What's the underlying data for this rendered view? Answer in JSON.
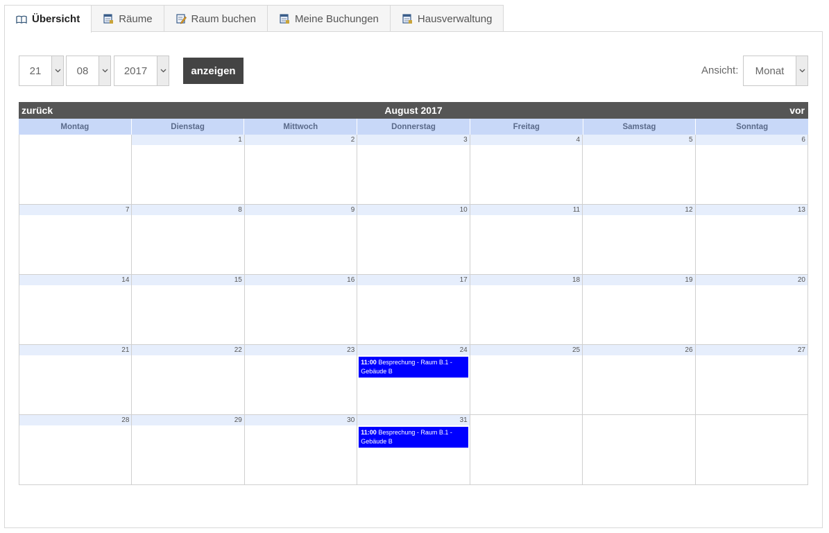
{
  "tabs": [
    {
      "label": "Übersicht",
      "icon": "book-icon",
      "active": true
    },
    {
      "label": "Räume",
      "icon": "calendar-icon",
      "active": false
    },
    {
      "label": "Raum buchen",
      "icon": "edit-icon",
      "active": false
    },
    {
      "label": "Meine Buchungen",
      "icon": "calendar-icon",
      "active": false
    },
    {
      "label": "Hausverwaltung",
      "icon": "calendar-icon",
      "active": false
    }
  ],
  "date_picker": {
    "day": "21",
    "month": "08",
    "year": "2017"
  },
  "show_button": "anzeigen",
  "view": {
    "label": "Ansicht:",
    "value": "Monat"
  },
  "calendar": {
    "prev": "zurück",
    "next": "vor",
    "title": "August 2017",
    "weekdays": [
      "Montag",
      "Dienstag",
      "Mittwoch",
      "Donnerstag",
      "Freitag",
      "Samstag",
      "Sonntag"
    ],
    "weeks": [
      [
        "",
        "1",
        "2",
        "3",
        "4",
        "5",
        "6"
      ],
      [
        "7",
        "8",
        "9",
        "10",
        "11",
        "12",
        "13"
      ],
      [
        "14",
        "15",
        "16",
        "17",
        "18",
        "19",
        "20"
      ],
      [
        "21",
        "22",
        "23",
        "24",
        "25",
        "26",
        "27"
      ],
      [
        "28",
        "29",
        "30",
        "31",
        "",
        "",
        ""
      ]
    ],
    "events": [
      {
        "date": "24",
        "time": "11:00",
        "text": "Besprechung - Raum B.1 - Gebäude B"
      },
      {
        "date": "31",
        "time": "11:00",
        "text": "Besprechung - Raum B.1 - Gebäude B"
      }
    ]
  },
  "colors": {
    "event": "#0000ff",
    "header": "#555555",
    "weekday_header": "#c8d8f8",
    "day_number_bar": "#e6eefc"
  }
}
